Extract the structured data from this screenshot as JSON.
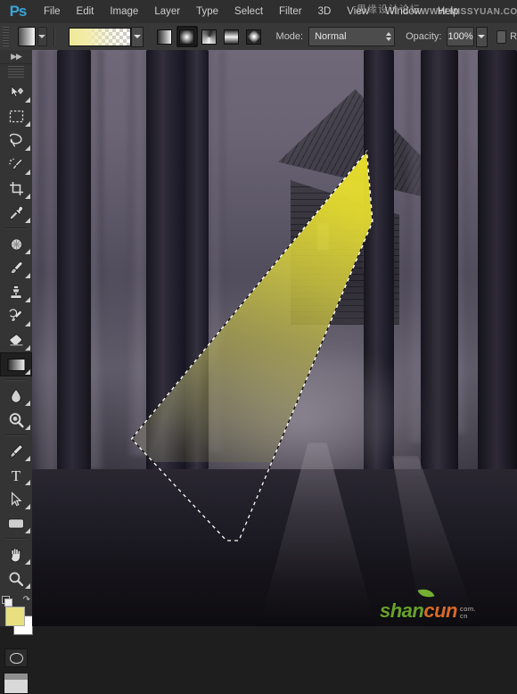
{
  "app": {
    "name": "Adobe Photoshop",
    "logo_text": "Ps"
  },
  "menubar": {
    "items": [
      {
        "label": "File"
      },
      {
        "label": "Edit"
      },
      {
        "label": "Image"
      },
      {
        "label": "Layer"
      },
      {
        "label": "Type"
      },
      {
        "label": "Select"
      },
      {
        "label": "Filter"
      },
      {
        "label": "3D"
      },
      {
        "label": "View"
      },
      {
        "label": "Window"
      },
      {
        "label": "Help"
      }
    ],
    "watermark_cn": "思缘设计论坛",
    "watermark_en": "WWW.MISSYUAN.COM"
  },
  "options_bar": {
    "tool_preset_name": "gradient-tool-preset",
    "gradient_preview_name": "yellow-to-transparent",
    "gradient_types": [
      {
        "name": "linear-gradient",
        "label": "Linear Gradient",
        "selected": false
      },
      {
        "name": "radial-gradient",
        "label": "Radial Gradient",
        "selected": true
      },
      {
        "name": "angle-gradient",
        "label": "Angle Gradient",
        "selected": false
      },
      {
        "name": "reflected-gradient",
        "label": "Reflected Gradient",
        "selected": false
      },
      {
        "name": "diamond-gradient",
        "label": "Diamond Gradient",
        "selected": false
      }
    ],
    "mode_label": "Mode:",
    "mode_value": "Normal",
    "opacity_label": "Opacity:",
    "opacity_value": "100%",
    "reverse_label": "R"
  },
  "toolbar": {
    "tools": [
      {
        "name": "move-tool",
        "label": "Move Tool"
      },
      {
        "name": "rectangular-marquee-tool",
        "label": "Rectangular Marquee Tool"
      },
      {
        "name": "lasso-tool",
        "label": "Lasso Tool"
      },
      {
        "name": "quick-selection-tool",
        "label": "Quick Selection Tool"
      },
      {
        "name": "crop-tool",
        "label": "Crop Tool"
      },
      {
        "name": "eyedropper-tool",
        "label": "Eyedropper Tool"
      },
      {
        "name": "spot-healing-brush-tool",
        "label": "Spot Healing Brush Tool"
      },
      {
        "name": "brush-tool",
        "label": "Brush Tool"
      },
      {
        "name": "clone-stamp-tool",
        "label": "Clone Stamp Tool"
      },
      {
        "name": "history-brush-tool",
        "label": "History Brush Tool"
      },
      {
        "name": "eraser-tool",
        "label": "Eraser Tool"
      },
      {
        "name": "gradient-tool",
        "label": "Gradient Tool",
        "selected": true
      },
      {
        "name": "blur-tool",
        "label": "Blur Tool"
      },
      {
        "name": "dodge-tool",
        "label": "Dodge Tool"
      },
      {
        "name": "pen-tool",
        "label": "Pen Tool"
      },
      {
        "name": "horizontal-type-tool",
        "label": "T"
      },
      {
        "name": "path-selection-tool",
        "label": "Path Selection Tool"
      },
      {
        "name": "rectangle-tool",
        "label": "Rectangle Tool"
      },
      {
        "name": "hand-tool",
        "label": "Hand Tool"
      },
      {
        "name": "zoom-tool",
        "label": "Zoom Tool"
      }
    ],
    "foreground_color": "#e8e07e",
    "background_color": "#ffffff",
    "swap_colors_label": "swap-colors",
    "quick_mask_label": "Edit in Quick Mask Mode",
    "screen_mode_label": "Change Screen Mode"
  },
  "canvas": {
    "description": "Dark foggy forest photograph with an abandoned wooden house and a yellow light-beam gradient inside an active selection",
    "selection_active": true,
    "beam_color_top": "#ece22a",
    "beam_color_bottom": "#605e4a",
    "watermark": {
      "text_green": "shan",
      "text_orange": "cun",
      "domain_line1": "com.",
      "domain_line2": "cn"
    }
  }
}
